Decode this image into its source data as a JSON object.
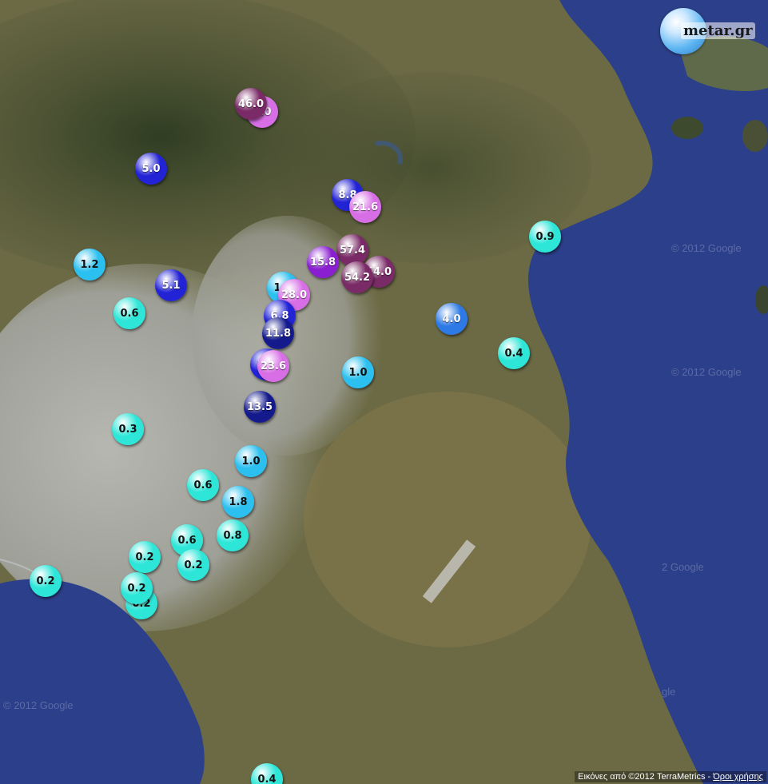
{
  "logo": {
    "text": "metar.gr"
  },
  "attribution": {
    "text": "Εικόνες από ©2012 TerraMetrics - ",
    "link": "Όροι χρήσης"
  },
  "watermarks": [
    "© 2012 Google",
    "© 2012 Google",
    "2 Google",
    "© 2012 Google",
    "gle"
  ],
  "colors": {
    "sea": "#2c3f8a",
    "land": "#6b6a45",
    "urban": "#a7a8a2",
    "cyan": "#2ee6d8",
    "light_blue": "#2bc0ef",
    "mid_blue": "#2d7ae6",
    "blue": "#2323d6",
    "dark_blue": "#141a8c",
    "purple": "#8a1fd1",
    "violet": "#d86ee6",
    "plum": "#7a2a66"
  },
  "markers": [
    {
      "value": "1.0",
      "color": "violet"
    },
    {
      "value": "46.0",
      "color": "plum"
    },
    {
      "value": "5.0",
      "color": "blue"
    },
    {
      "value": "8.8",
      "color": "blue"
    },
    {
      "value": "21.6",
      "color": "violet"
    },
    {
      "value": "0.9",
      "color": "cyan"
    },
    {
      "value": "1.2",
      "color": "light_blue"
    },
    {
      "value": "5.1",
      "color": "blue"
    },
    {
      "value": "57.4",
      "color": "plum"
    },
    {
      "value": "54.0",
      "color": "plum"
    },
    {
      "value": "15.8",
      "color": "purple"
    },
    {
      "value": "54.2",
      "color": "plum"
    },
    {
      "value": "1.0",
      "color": "light_blue"
    },
    {
      "value": "28.0",
      "color": "violet"
    },
    {
      "value": "0.6",
      "color": "cyan"
    },
    {
      "value": "6.8",
      "color": "blue"
    },
    {
      "value": "4.0",
      "color": "mid_blue"
    },
    {
      "value": "11.8",
      "color": "dark_blue"
    },
    {
      "value": "0.4",
      "color": "cyan"
    },
    {
      "value": "1.0",
      "color": "blue"
    },
    {
      "value": "23.6",
      "color": "violet"
    },
    {
      "value": "1.0",
      "color": "light_blue"
    },
    {
      "value": "13.5",
      "color": "dark_blue"
    },
    {
      "value": "0.3",
      "color": "cyan"
    },
    {
      "value": "1.0",
      "color": "light_blue"
    },
    {
      "value": "0.6",
      "color": "cyan"
    },
    {
      "value": "1.8",
      "color": "light_blue"
    },
    {
      "value": "0.6",
      "color": "cyan"
    },
    {
      "value": "0.8",
      "color": "cyan"
    },
    {
      "value": "0.2",
      "color": "cyan"
    },
    {
      "value": "0.2",
      "color": "cyan"
    },
    {
      "value": "0.2",
      "color": "cyan"
    },
    {
      "value": "0.2",
      "color": "cyan"
    },
    {
      "value": "0.2",
      "color": "cyan"
    },
    {
      "value": "0.4",
      "color": "cyan"
    }
  ]
}
